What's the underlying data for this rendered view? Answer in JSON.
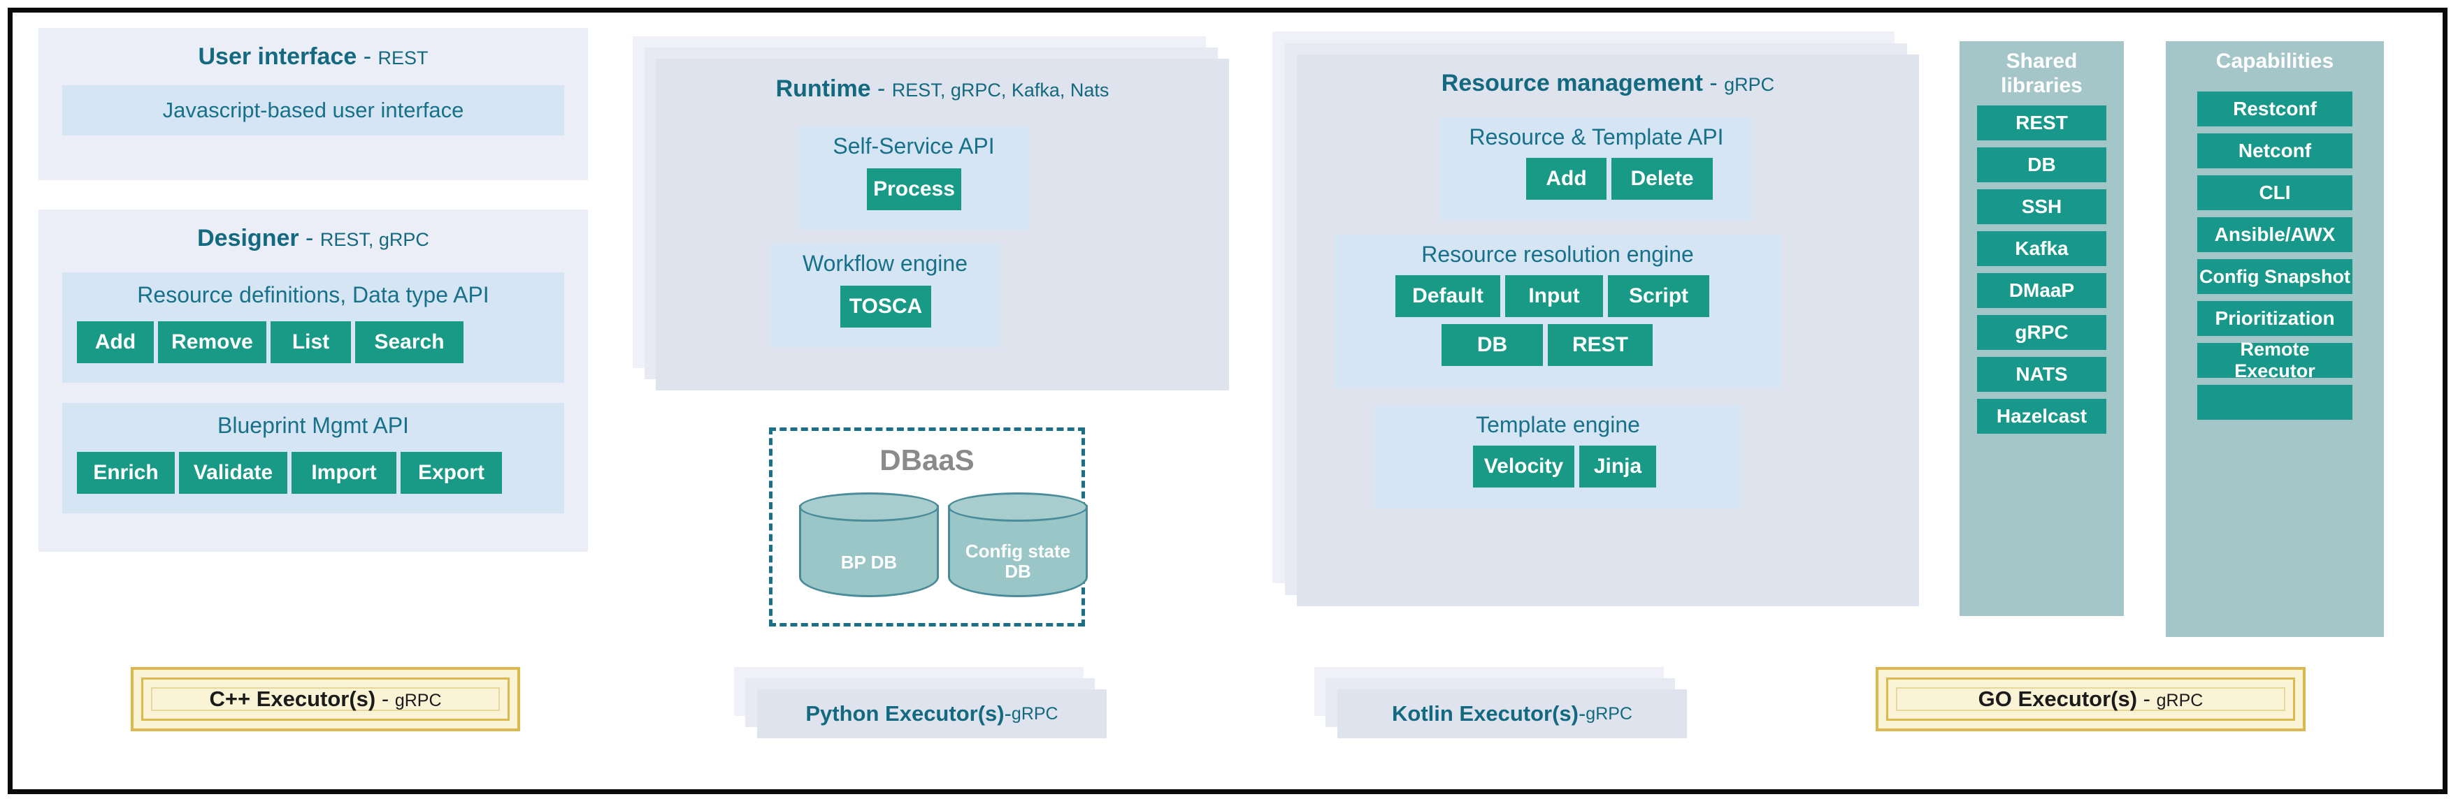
{
  "diagram": {
    "title_color": "#13697f",
    "chip_color": "#189a86",
    "panel_color": "#dfe3ee",
    "subpanel_color": "#d6e5f3",
    "sidecol_color": "#a4c6c9",
    "gold_color": "#dcb94e"
  },
  "user_interface": {
    "title_main": "User interface",
    "title_sep": " - ",
    "title_proto": "REST",
    "box_label": "Javascript-based user interface"
  },
  "designer": {
    "title_main": "Designer",
    "title_sep": " - ",
    "title_proto": "REST, gRPC",
    "groups": [
      {
        "label": "Resource definitions, Data type API",
        "chips": [
          "Add",
          "Remove",
          "List",
          "Search"
        ]
      },
      {
        "label": "Blueprint Mgmt API",
        "chips": [
          "Enrich",
          "Validate",
          "Import",
          "Export"
        ]
      }
    ]
  },
  "runtime": {
    "title_main": "Runtime",
    "title_sep": " - ",
    "title_proto": "REST, gRPC, Kafka, Nats",
    "groups": [
      {
        "label": "Self-Service API",
        "chips": [
          "Process"
        ]
      },
      {
        "label": "Workflow engine",
        "chips": [
          "TOSCA"
        ]
      }
    ]
  },
  "dbaas": {
    "title": "DBaaS",
    "databases": [
      {
        "label": "BP DB"
      },
      {
        "label": "Config state\nDB"
      }
    ]
  },
  "resource_management": {
    "title_main": "Resource management",
    "title_sep": " - ",
    "title_proto": "gRPC",
    "groups": [
      {
        "label": "Resource & Template API",
        "rows": [
          [
            "Add",
            "Delete"
          ]
        ]
      },
      {
        "label": "Resource resolution engine",
        "rows": [
          [
            "Default",
            "Input",
            "Script"
          ],
          [
            "DB",
            "REST"
          ]
        ]
      },
      {
        "label": "Template engine",
        "rows": [
          [
            "Velocity",
            "Jinja"
          ]
        ]
      }
    ]
  },
  "shared_libraries": {
    "title": "Shared\nlibraries",
    "items": [
      "REST",
      "DB",
      "SSH",
      "Kafka",
      "DMaaP",
      "gRPC",
      "NATS",
      "Hazelcast"
    ]
  },
  "capabilities": {
    "title": "Capabilities",
    "items": [
      "Restconf",
      "Netconf",
      "CLI",
      "Ansible/AWX",
      "Config Snapshot",
      "Prioritization",
      "Remote Executor",
      ""
    ]
  },
  "executors": [
    {
      "name_main": "C++ Executor(s)",
      "sep": " - ",
      "proto": "gRPC",
      "style": "gold"
    },
    {
      "name_main": "Python Executor(s)",
      "sep": " - ",
      "proto": "gRPC",
      "style": "stack"
    },
    {
      "name_main": "Kotlin Executor(s)",
      "sep": " - ",
      "proto": "gRPC",
      "style": "stack"
    },
    {
      "name_main": "GO Executor(s)",
      "sep": " - ",
      "proto": "gRPC",
      "style": "gold"
    }
  ]
}
